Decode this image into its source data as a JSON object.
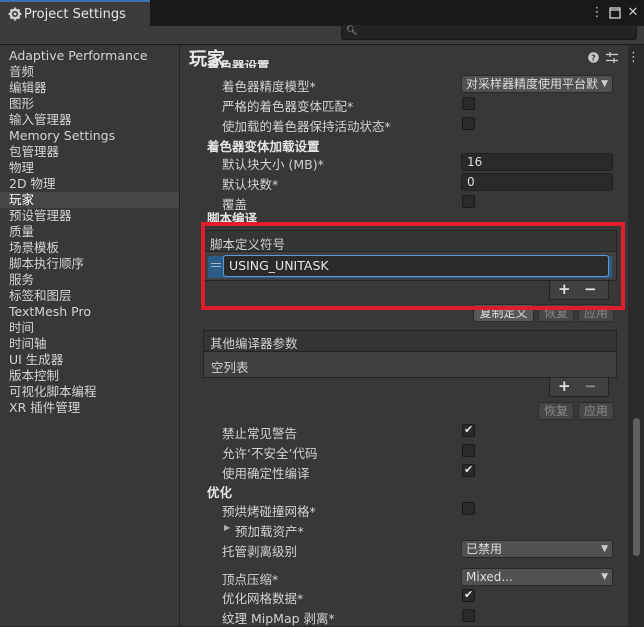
{
  "window": {
    "title": "Project Settings"
  },
  "toolbar": {
    "menu_icon": "kebab-menu-icon",
    "maximize_icon": "maximize-icon",
    "close_icon": "close-icon"
  },
  "search": {
    "placeholder": "",
    "icon": "search-icon"
  },
  "sidebar": {
    "items": [
      {
        "label": "Adaptive Performance"
      },
      {
        "label": "音频"
      },
      {
        "label": "编辑器"
      },
      {
        "label": "图形"
      },
      {
        "label": "输入管理器"
      },
      {
        "label": "Memory Settings"
      },
      {
        "label": "包管理器"
      },
      {
        "label": "物理"
      },
      {
        "label": "2D 物理"
      },
      {
        "label": "玩家",
        "selected": true
      },
      {
        "label": "预设管理器"
      },
      {
        "label": "质量"
      },
      {
        "label": "场景模板"
      },
      {
        "label": "脚本执行顺序"
      },
      {
        "label": "服务"
      },
      {
        "label": "标签和图层"
      },
      {
        "label": "TextMesh Pro"
      },
      {
        "label": "时间"
      },
      {
        "label": "时间轴"
      },
      {
        "label": "UI 生成器"
      },
      {
        "label": "版本控制"
      },
      {
        "label": "可视化脚本编程"
      },
      {
        "label": "XR 插件管理"
      }
    ]
  },
  "main": {
    "title": "玩家",
    "partial_header": "着色器设置",
    "shader": {
      "precision_label": "着色器精度模型*",
      "precision_value": "对采样器精度使用平台默",
      "strict_variant_label": "严格的着色器变体匹配*",
      "keep_loaded_label": "使加载的着色器保持活动状态*"
    },
    "variant_loading": {
      "title": "着色器变体加载设置",
      "chunk_size_label": "默认块大小 (MB)*",
      "chunk_size_value": "16",
      "chunk_count_label": "默认块数*",
      "chunk_count_value": "0",
      "override_label": "覆盖"
    },
    "script_compilation_partial": "脚本编译",
    "define_symbols": {
      "title": "脚本定义符号",
      "items": [
        "USING_UNITASK"
      ],
      "add": "+",
      "remove": "−",
      "copy_button": "复制定义",
      "revert_button": "恢复",
      "apply_button": "应用"
    },
    "compiler_args": {
      "title": "其他编译器参数",
      "empty_text": "空列表",
      "add": "+",
      "remove": "−",
      "revert_button": "恢复",
      "apply_button": "应用"
    },
    "options": {
      "suppress_warnings_label": "禁止常见警告",
      "suppress_warnings": true,
      "unsafe_code_label": "允许‘不安全’代码",
      "unsafe_code": false,
      "deterministic_label": "使用确定性编译",
      "deterministic": true
    },
    "optimization": {
      "title": "优化",
      "prebake_label": "预烘烤碰撞网格*",
      "prebake": false,
      "preloaded_assets_label": "预加载资产*",
      "managed_stripping_label": "托管剥离级别",
      "managed_stripping_value": "已禁用",
      "vertex_compression_label": "顶点压缩*",
      "vertex_compression_value": "Mixed...",
      "optimize_mesh_label": "优化网格数据*",
      "optimize_mesh": true,
      "mipmap_stripping_label": "纹理 MipMap 剥离*",
      "mipmap_stripping": false
    }
  },
  "colors": {
    "highlight_box": "#e01e2a",
    "accent": "#3a72b0"
  }
}
